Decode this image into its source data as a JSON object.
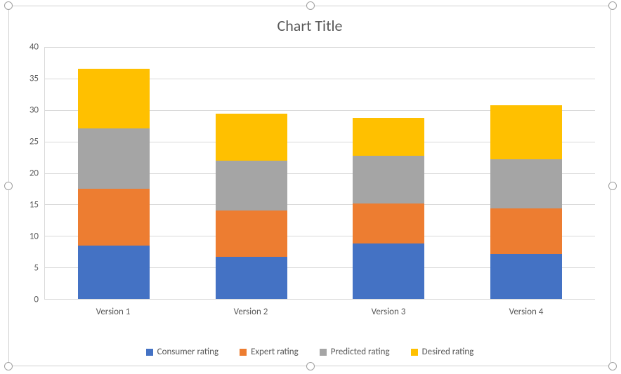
{
  "chart_data": {
    "type": "bar",
    "stacked": true,
    "title": "Chart Title",
    "categories": [
      "Version 1",
      "Version 2",
      "Version 3",
      "Version 4"
    ],
    "series": [
      {
        "name": "Consumer rating",
        "color": "#4472C4",
        "values": [
          8.5,
          6.7,
          8.8,
          7.1
        ]
      },
      {
        "name": "Expert rating",
        "color": "#ED7D31",
        "values": [
          9.0,
          7.3,
          6.4,
          7.3
        ]
      },
      {
        "name": "Predicted rating",
        "color": "#A5A5A5",
        "values": [
          9.6,
          7.9,
          7.5,
          7.8
        ]
      },
      {
        "name": "Desired rating",
        "color": "#FFC000",
        "values": [
          9.5,
          7.5,
          6.0,
          8.5
        ]
      }
    ],
    "ylim": [
      0,
      40
    ],
    "ytick_step": 5,
    "xlabel": "",
    "ylabel": ""
  }
}
